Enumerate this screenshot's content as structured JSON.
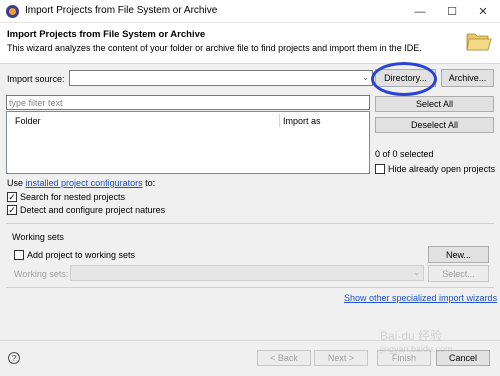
{
  "window": {
    "title": "Import Projects from File System or Archive",
    "minimize": "—",
    "maximize": "☐",
    "close": "✕"
  },
  "header": {
    "title": "Import Projects from File System or Archive",
    "description": "This wizard analyzes the content of your folder or archive file to find projects and import them in the IDE."
  },
  "source": {
    "label": "Import source:",
    "value": "",
    "directory_button": "Directory...",
    "archive_button": "Archive..."
  },
  "filter": {
    "placeholder": "type filter text"
  },
  "table": {
    "columns": [
      "Folder",
      "Import as"
    ]
  },
  "side": {
    "select_all": "Select All",
    "deselect_all": "Deselect All",
    "selected_count": "0 of 0 selected",
    "hide_open_label": "Hide already open projects"
  },
  "options": {
    "use_prefix": "Use",
    "configurators_link": "installed project configurators",
    "use_suffix": "to:",
    "nested_label": "Search for nested projects",
    "detect_label": "Detect and configure project natures"
  },
  "working_sets": {
    "group_title": "Working sets",
    "add_label": "Add project to working sets",
    "new_button": "New...",
    "sets_label": "Working sets:",
    "select_button": "Select..."
  },
  "footer": {
    "show_wizards_link": "Show other specialized import wizards",
    "help": "?",
    "back": "< Back",
    "next": "Next >",
    "finish": "Finish",
    "cancel": "Cancel"
  },
  "watermark": {
    "text": "Bai·du 经验",
    "url": "jingyan.baidu.com"
  },
  "colors": {
    "link": "#1f53c7",
    "annotation_circle": "#2744d6"
  }
}
